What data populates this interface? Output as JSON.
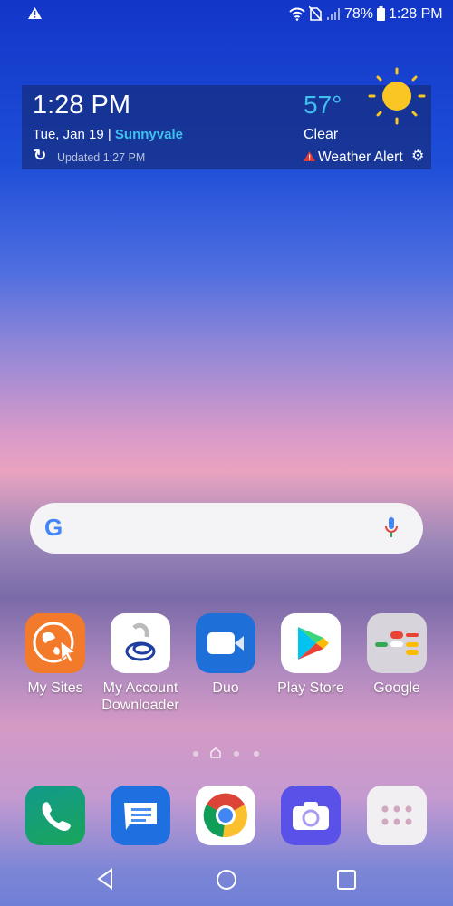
{
  "status_bar": {
    "alert_icon": "warning-icon",
    "battery": "78%",
    "time": "1:28 PM"
  },
  "widget": {
    "time": "1:28 PM",
    "date": "Tue, Jan 19",
    "separator": "|",
    "location": "Sunnyvale",
    "updated": "Updated 1:27 PM",
    "temperature": "57°",
    "condition": "Clear",
    "alert": "Weather Alert",
    "weather_icon": "sun-icon"
  },
  "search": {
    "logo": "G",
    "mic_icon": "mic-icon"
  },
  "apps": [
    {
      "label": "My Sites"
    },
    {
      "label": "My Account Downloader"
    },
    {
      "label": "Duo"
    },
    {
      "label": "Play Store"
    },
    {
      "label": "Google"
    }
  ],
  "dock": [
    {
      "name": "phone"
    },
    {
      "name": "messages"
    },
    {
      "name": "chrome"
    },
    {
      "name": "camera"
    },
    {
      "name": "app-drawer"
    }
  ],
  "page_indicator": {
    "pages": 4,
    "current": 2
  },
  "colors": {
    "accent": "#3fc0ee",
    "sun": "#f9c623",
    "alert": "#e53935"
  }
}
